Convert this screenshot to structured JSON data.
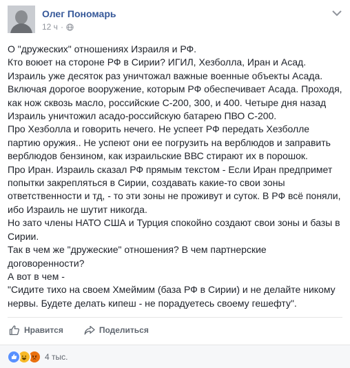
{
  "colors": {
    "link": "#365899",
    "text": "#1d2129",
    "muted": "#90949c",
    "action": "#606770",
    "like_blue": "#5890ff",
    "haha_yellow": "#f7b928",
    "angry_orange": "#e9710f"
  },
  "post": {
    "author": "Олег Пономарь",
    "time": "12 ч",
    "separator": "·",
    "lines": [
      "О \"дружеских\" отношениях Израиля и РФ.",
      "Кто воюет на стороне РФ в Сирии? ИГИЛ, Хезболла, Иран и Асад.",
      "Израиль уже десяток раз уничтожал важные военные объекты Асада.",
      "Включая дорогое вооружение, которым РФ обеспечивает Асада. Проходя,",
      "как нож сквозь масло, российские С-200, 300, и 400. Четыре дня назад",
      "Израиль уничтожил асадо-российскую батарею ПВО С-200.",
      "Про Хезболла и говорить нечего. Не успеет РФ передать Хезболле",
      "партию оружия.. Не успеют они ее погрузить на верблюдов и заправить",
      "верблюдов бензином, как израильские ВВС стирают их в порошок.",
      "Про Иран. Израиль сказал РФ прямым текстом - Если Иран предпримет",
      "попытки закрепляться в Сирии, создавать какие-то свои зоны",
      "ответственности и тд, - то эти зоны не проживут и суток. В РФ всё поняли,",
      "ибо Израиль не шутит никогда.",
      "Но зато члены НАТО США и Турция спокойно создают свои зоны и базы в",
      "Сирии.",
      "Так в чем же \"дружеские\" отношения? В чем партнерские",
      "договоренности?",
      "А вот в чем -",
      "\"Сидите тихо на своем Хмеймим (база РФ в Сирии) и не делайте никому",
      "нервы. Будете делать кипеш - не порадуетесь своему гешефту\"."
    ]
  },
  "actions": {
    "like_label": "Нравится",
    "share_label": "Поделиться"
  },
  "reactions": {
    "count": "4 тыс.",
    "types": [
      "like",
      "haha",
      "angry"
    ]
  },
  "icons": {
    "like": "thumbs-up-icon",
    "share": "share-arrow-icon",
    "privacy": "globe-icon",
    "more": "chevron-down-icon"
  }
}
